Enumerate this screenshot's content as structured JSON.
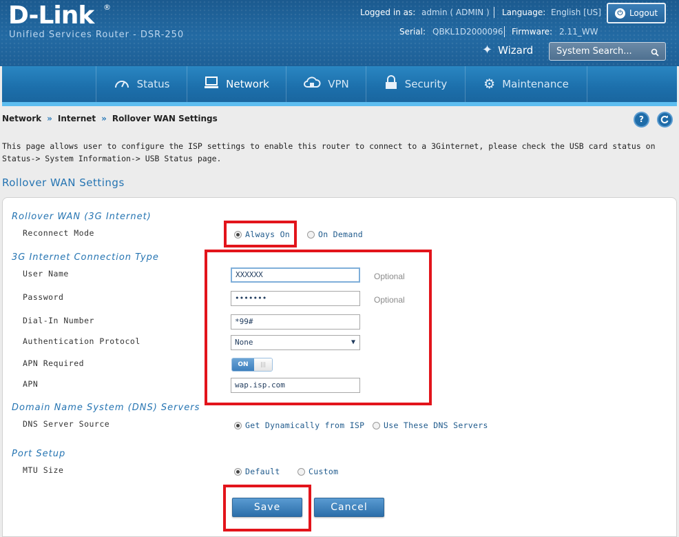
{
  "header": {
    "logo": "D-Link",
    "logo_reg": "®",
    "subtitle": "Unified Services Router - DSR-250",
    "logged_in_label": "Logged in as:",
    "logged_in_value": "admin ( ADMIN )",
    "language_label": "Language:",
    "language_value": "English [US]",
    "serial_label": "Serial:",
    "serial_value": "QBKL1D2000096",
    "firmware_label": "Firmware:",
    "firmware_value": "2.11_WW",
    "logout_label": "Logout",
    "wizard_label": "Wizard",
    "search_placeholder": "System Search..."
  },
  "nav": {
    "items": [
      {
        "label": "Status",
        "icon": "dashboard-icon"
      },
      {
        "label": "Network",
        "icon": "monitor-icon"
      },
      {
        "label": "VPN",
        "icon": "cloud-lock-icon"
      },
      {
        "label": "Security",
        "icon": "lock-icon"
      },
      {
        "label": "Maintenance",
        "icon": "gears-icon"
      }
    ],
    "active": "Network"
  },
  "breadcrumb": [
    "Network",
    "Internet",
    "Rollover WAN Settings"
  ],
  "breadcrumb_sep": "»",
  "description": "This page allows user to configure the ISP settings to enable this router to connect to a 3Ginternet, please check the USB card status on Status-> System Information-> USB Status page.",
  "section_heading": "Rollover WAN Settings",
  "form": {
    "group_rollover": "Rollover WAN (3G Internet)",
    "reconnect_mode_label": "Reconnect Mode",
    "reconnect_always_on": "Always On",
    "reconnect_on_demand": "On Demand",
    "reconnect_selected": "Always On",
    "group_connection": "3G Internet Connection Type",
    "user_name_label": "User Name",
    "user_name_value": "XXXXXX",
    "user_name_hint": "Optional",
    "password_label": "Password",
    "password_value": "•••••••",
    "password_hint": "Optional",
    "dialin_label": "Dial-In Number",
    "dialin_value": "*99#",
    "auth_label": "Authentication Protocol",
    "auth_value": "None",
    "apn_required_label": "APN Required",
    "apn_required_state": "ON",
    "apn_label": "APN",
    "apn_value": "wap.isp.com",
    "group_dns": "Domain Name System (DNS) Servers",
    "dns_source_label": "DNS Server Source",
    "dns_dynamic": "Get Dynamically from ISP",
    "dns_custom": "Use These DNS Servers",
    "dns_selected": "Get Dynamically from ISP",
    "group_port": "Port Setup",
    "mtu_label": "MTU Size",
    "mtu_default": "Default",
    "mtu_custom": "Custom",
    "mtu_selected": "Default",
    "save_label": "Save",
    "cancel_label": "Cancel"
  },
  "colors": {
    "accent": "#2574b2",
    "header_bg": "#1b5a8f",
    "nav_bg": "#1c6fab",
    "highlight": "#e2141b"
  }
}
